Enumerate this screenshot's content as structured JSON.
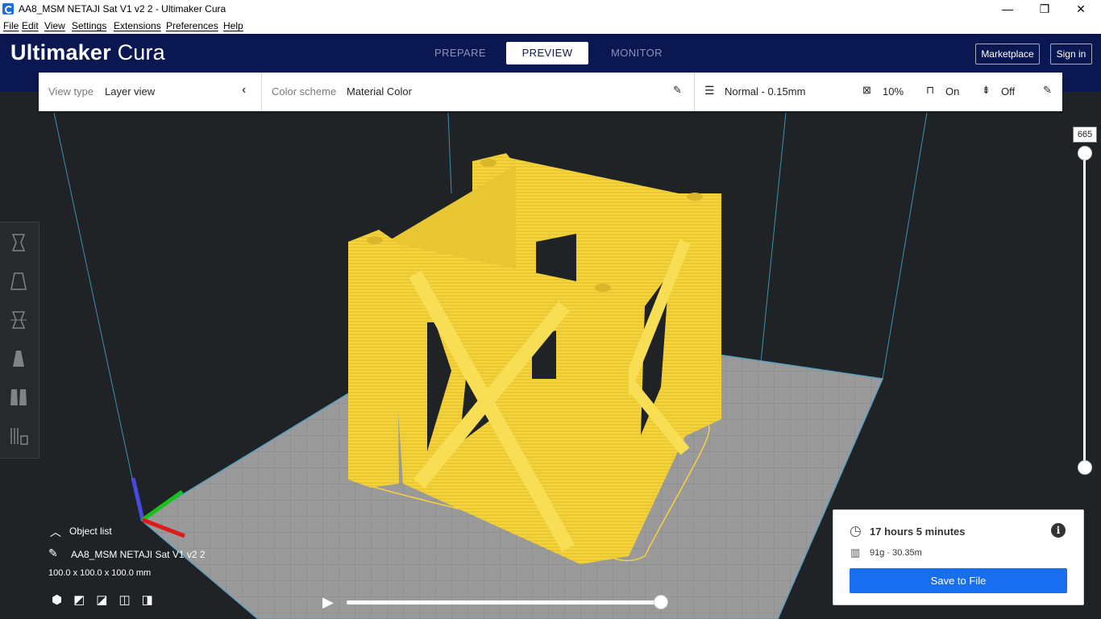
{
  "window": {
    "title": "AA8_MSM NETAJI Sat V1 v2 2 - Ultimaker Cura",
    "minimize_glyph": "—",
    "restore_glyph": "❐",
    "close_glyph": "✕"
  },
  "menu": {
    "items": [
      "File",
      "Edit",
      "View",
      "Settings",
      "Extensions",
      "Preferences",
      "Help"
    ]
  },
  "header": {
    "logo_bold": "Ultimaker",
    "logo_light": "Cura",
    "tabs": [
      "PREPARE",
      "PREVIEW",
      "MONITOR"
    ],
    "active_tab": "PREVIEW",
    "marketplace_label": "Marketplace",
    "signin_label": "Sign in"
  },
  "toolbar": {
    "view_type_label": "View type",
    "view_type_value": "Layer view",
    "color_scheme_label": "Color scheme",
    "color_scheme_value": "Material Color",
    "profile": "Normal - 0.15mm",
    "infill": "10%",
    "support": "On",
    "adhesion": "Off"
  },
  "layer_slider": {
    "current_layer": "665"
  },
  "object_list": {
    "header": "Object list",
    "object_name": "AA8_MSM NETAJI Sat V1 v2 2",
    "dimensions": "100.0 x 100.0 x 100.0 mm"
  },
  "print_info": {
    "time": "17 hours 5 minutes",
    "material": "91g · 30.35m",
    "save_label": "Save to File"
  },
  "colors": {
    "header_bg": "#0b1750",
    "model_yellow": "#f5d33b",
    "accent_blue": "#196ef0"
  }
}
